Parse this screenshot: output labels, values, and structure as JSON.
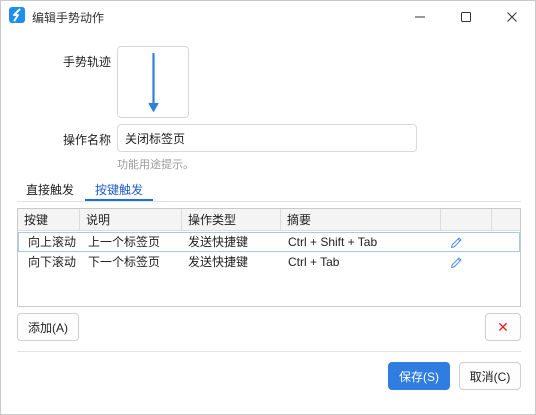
{
  "window": {
    "title": "编辑手势动作",
    "icon": "app-logo-icon"
  },
  "form": {
    "gesture_label": "手势轨迹",
    "gesture_shape": "arrow-down",
    "name_label": "操作名称",
    "name_value": "关闭标签页",
    "hint": "功能用途提示。"
  },
  "tabs": [
    {
      "label": "直接触发",
      "active": false
    },
    {
      "label": "按键触发",
      "active": true
    }
  ],
  "table": {
    "headers": [
      "按键",
      "说明",
      "操作类型",
      "摘要"
    ],
    "rows": [
      {
        "key": "向上滚动",
        "desc": "上一个标签页",
        "type": "发送快捷键",
        "summary": "Ctrl + Shift + Tab",
        "selected": true
      },
      {
        "key": "向下滚动",
        "desc": "下一个标签页",
        "type": "发送快捷键",
        "summary": "Ctrl + Tab",
        "selected": false
      }
    ]
  },
  "buttons": {
    "add": "添加(A)",
    "delete": "✕",
    "save": "保存(S)",
    "cancel": "取消(C)"
  },
  "colors": {
    "accent": "#2f7de1",
    "gesture_stroke": "#2f80d8",
    "delete_red": "#e02020"
  }
}
